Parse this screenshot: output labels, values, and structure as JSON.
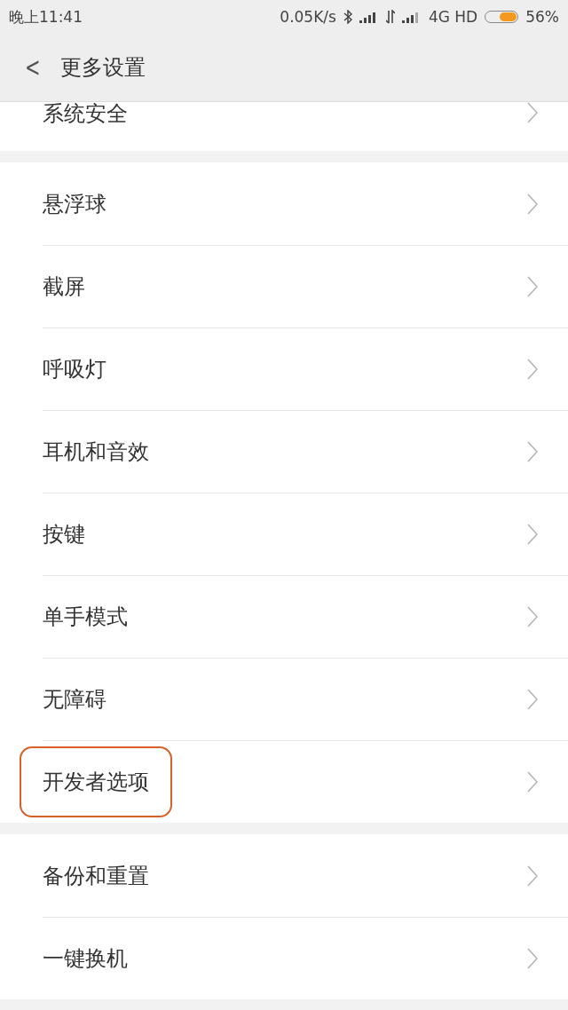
{
  "status_bar": {
    "time": "晚上11:41",
    "speed": "0.05K/s",
    "network": "4G HD",
    "battery": "56%"
  },
  "header": {
    "back": "<",
    "title": "更多设置"
  },
  "groups": [
    {
      "items": [
        {
          "label": "系统安全",
          "highlighted": false
        }
      ]
    },
    {
      "items": [
        {
          "label": "悬浮球",
          "highlighted": false
        },
        {
          "label": "截屏",
          "highlighted": false
        },
        {
          "label": "呼吸灯",
          "highlighted": false
        },
        {
          "label": "耳机和音效",
          "highlighted": false
        },
        {
          "label": "按键",
          "highlighted": false
        },
        {
          "label": "单手模式",
          "highlighted": false
        },
        {
          "label": "无障碍",
          "highlighted": false
        },
        {
          "label": "开发者选项",
          "highlighted": true
        }
      ]
    },
    {
      "items": [
        {
          "label": "备份和重置",
          "highlighted": false
        },
        {
          "label": "一键换机",
          "highlighted": false
        }
      ]
    }
  ]
}
